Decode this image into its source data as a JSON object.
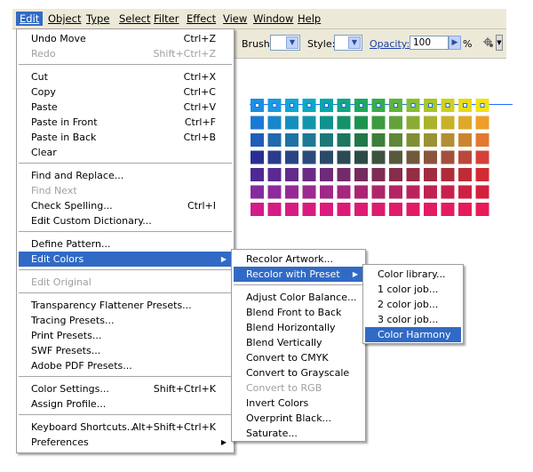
{
  "menubar": {
    "items": [
      {
        "label": "Edit",
        "active": true
      },
      {
        "label": "Object"
      },
      {
        "label": "Type"
      },
      {
        "label": "Select"
      },
      {
        "label": "Filter"
      },
      {
        "label": "Effect"
      },
      {
        "label": "View"
      },
      {
        "label": "Window"
      },
      {
        "label": "Help"
      }
    ]
  },
  "toolbar": {
    "brush_label": "Brush:",
    "style_label": "Style:",
    "opacity_label": "Opacity:",
    "opacity_value": "100",
    "percent": "%"
  },
  "edit_menu": {
    "items": [
      {
        "label": "Undo Move",
        "shortcut": "Ctrl+Z"
      },
      {
        "label": "Redo",
        "shortcut": "Shift+Ctrl+Z",
        "disabled": true
      },
      {
        "label": "Cut",
        "shortcut": "Ctrl+X"
      },
      {
        "label": "Copy",
        "shortcut": "Ctrl+C"
      },
      {
        "label": "Paste",
        "shortcut": "Ctrl+V"
      },
      {
        "label": "Paste in Front",
        "shortcut": "Ctrl+F"
      },
      {
        "label": "Paste in Back",
        "shortcut": "Ctrl+B"
      },
      {
        "label": "Clear",
        "shortcut": ""
      },
      {
        "label": "Find and Replace...",
        "shortcut": ""
      },
      {
        "label": "Find Next",
        "shortcut": "",
        "disabled": true
      },
      {
        "label": "Check Spelling...",
        "shortcut": "Ctrl+I"
      },
      {
        "label": "Edit Custom Dictionary...",
        "shortcut": ""
      },
      {
        "label": "Define Pattern...",
        "shortcut": ""
      },
      {
        "label": "Edit Colors",
        "shortcut": "",
        "submenu": true,
        "highlighted": true
      },
      {
        "label": "Edit Original",
        "shortcut": "",
        "disabled": true
      },
      {
        "label": "Transparency Flattener Presets...",
        "shortcut": ""
      },
      {
        "label": "Tracing Presets...",
        "shortcut": ""
      },
      {
        "label": "Print Presets...",
        "shortcut": ""
      },
      {
        "label": "SWF Presets...",
        "shortcut": ""
      },
      {
        "label": "Adobe PDF Presets...",
        "shortcut": ""
      },
      {
        "label": "Color Settings...",
        "shortcut": "Shift+Ctrl+K"
      },
      {
        "label": "Assign Profile...",
        "shortcut": ""
      },
      {
        "label": "Keyboard Shortcuts...",
        "shortcut": "Alt+Shift+Ctrl+K"
      },
      {
        "label": "Preferences",
        "shortcut": "",
        "submenu": true
      }
    ]
  },
  "edit_colors_menu": {
    "items": [
      {
        "label": "Recolor Artwork..."
      },
      {
        "label": "Recolor with Preset",
        "submenu": true,
        "highlighted": true
      },
      {
        "label": "Adjust Color Balance..."
      },
      {
        "label": "Blend Front to Back"
      },
      {
        "label": "Blend Horizontally"
      },
      {
        "label": "Blend Vertically"
      },
      {
        "label": "Convert to CMYK"
      },
      {
        "label": "Convert to Grayscale"
      },
      {
        "label": "Convert to RGB",
        "disabled": true
      },
      {
        "label": "Invert Colors"
      },
      {
        "label": "Overprint Black..."
      },
      {
        "label": "Saturate..."
      }
    ]
  },
  "preset_menu": {
    "items": [
      {
        "label": "Color library..."
      },
      {
        "label": "1 color job..."
      },
      {
        "label": "2 color job..."
      },
      {
        "label": "3 color job..."
      },
      {
        "label": "Color Harmony",
        "highlighted": true
      }
    ]
  },
  "swatches": {
    "rows": [
      [
        "#1a8fe0",
        "#1a9ae0",
        "#12a5d6",
        "#0ba8c4",
        "#0aa6a8",
        "#14a582",
        "#1da860",
        "#36ad47",
        "#5db53f",
        "#86bf34",
        "#aac62a",
        "#cfd020",
        "#e8db15",
        "#f3e310"
      ],
      [
        "#1a7ad6",
        "#1787cb",
        "#148fbd",
        "#1295ad",
        "#10928f",
        "#14916b",
        "#1e934f",
        "#3b9b3d",
        "#62a43a",
        "#8aac34",
        "#aab22e",
        "#c7b12a",
        "#dea92a",
        "#ef9e2a"
      ],
      [
        "#1e5db8",
        "#1f69b0",
        "#1e72a4",
        "#1e7896",
        "#1c7779",
        "#1c7660",
        "#22774a",
        "#3c7f3b",
        "#5d8838",
        "#7f8f36",
        "#9a9234",
        "#b38e32",
        "#cc8431",
        "#e27832"
      ],
      [
        "#292f92",
        "#2a3b8e",
        "#2a4386",
        "#2b497c",
        "#2b4a6a",
        "#2a4a55",
        "#2c4b46",
        "#3d523f",
        "#57593c",
        "#71593c",
        "#8a553c",
        "#a2503b",
        "#bb483b",
        "#d6403b"
      ],
      [
        "#4e2894",
        "#5a2992",
        "#632a8c",
        "#6a2b84",
        "#6e2b77",
        "#722b6a",
        "#762b5e",
        "#7e2c55",
        "#882c4c",
        "#942c44",
        "#a12c3e",
        "#ae2c38",
        "#bf2b35",
        "#d22a32"
      ],
      [
        "#842c9f",
        "#8d2b9b",
        "#952a96",
        "#9b298f",
        "#a02887",
        "#a5277e",
        "#aa2675",
        "#af256c",
        "#b42463",
        "#ba235a",
        "#c02252",
        "#c6214b",
        "#cd2044",
        "#d41f3d"
      ],
      [
        "#d31b8a",
        "#d51b86",
        "#d71b83",
        "#d91b7f",
        "#db1b7b",
        "#dc1b77",
        "#de1b73",
        "#df1b6f",
        "#e11b6b",
        "#e21b67",
        "#e31b63",
        "#e41b5f",
        "#e51b5b",
        "#e61b57"
      ]
    ]
  }
}
